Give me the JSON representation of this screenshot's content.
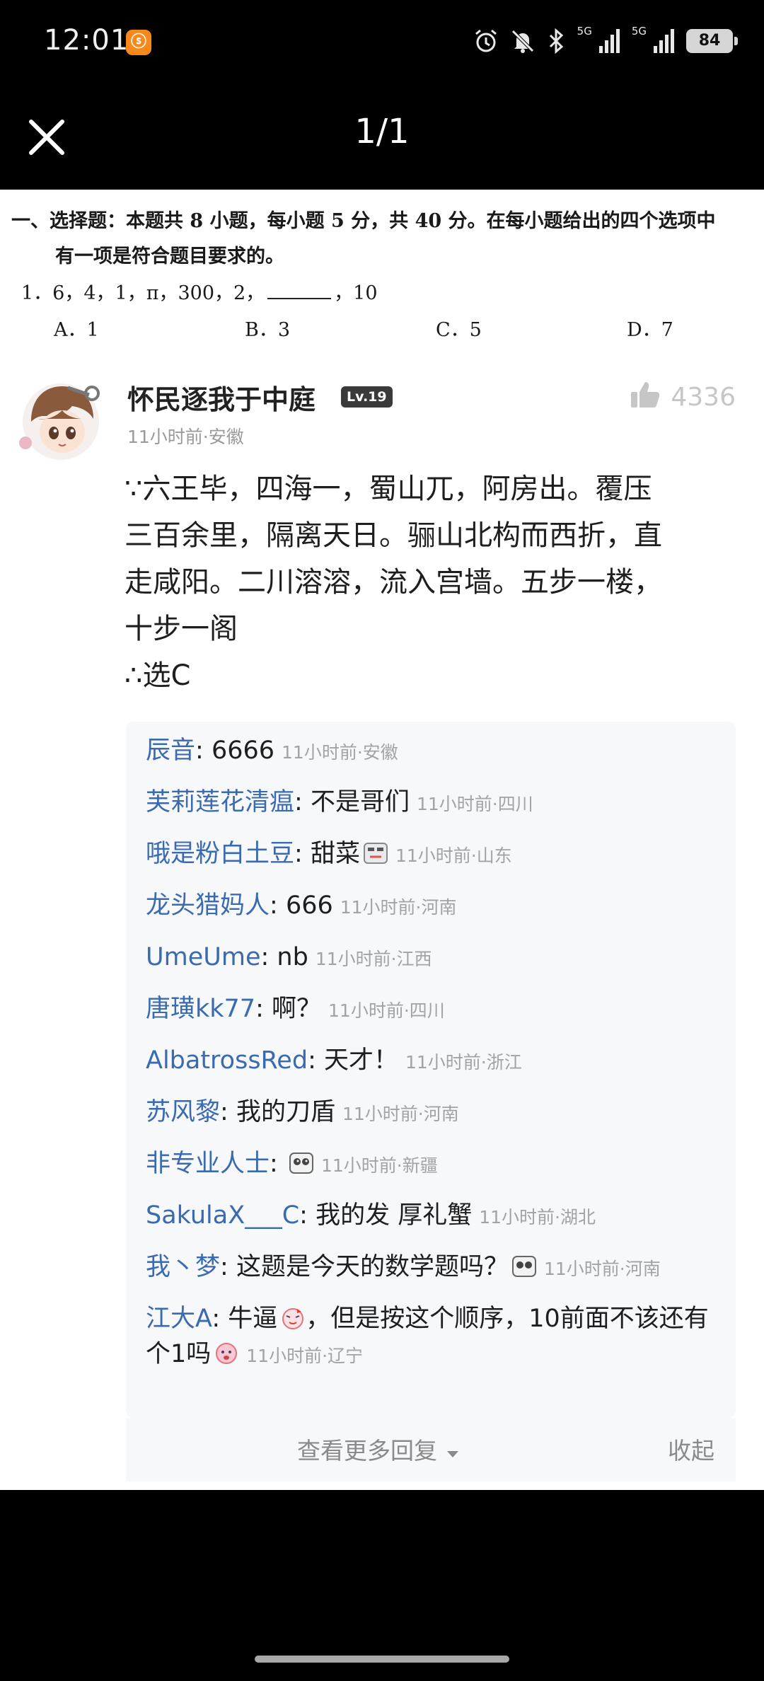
{
  "status_bar": {
    "time": "12:01",
    "net1": "5G",
    "net2": "5G",
    "battery": "84",
    "icons": [
      "alarm-icon",
      "mute-icon",
      "bluetooth-icon",
      "signal-icon",
      "signal-icon",
      "battery-icon"
    ]
  },
  "viewer": {
    "counter": "1/1",
    "close_icon": "close-icon"
  },
  "question": {
    "header_line1": "一、选择题：本题共 8 小题，每小题 5 分，共 40 分。在每小题给出的四个选项中",
    "header_line2": "有一项是符合题目要求的。",
    "stem_before": "1．6，4，1，π，300，2，",
    "stem_after": "，10",
    "options": [
      "A．1",
      "B．3",
      "C．5",
      "D．7"
    ]
  },
  "comment": {
    "username": "怀民逐我于中庭",
    "level": "Lv.19",
    "likes": "4336",
    "meta": "11小时前·安徽",
    "text_lines": [
      "∵六王毕，四海一，蜀山兀，阿房出。覆压",
      "三百余里，隔离天日。骊山北构而西折，直",
      "走咸阳。二川溶溶，流入宫墙。五步一楼，",
      "十步一阁",
      "∴选C"
    ]
  },
  "replies": [
    {
      "user": "辰音",
      "text": "6666",
      "time": "11小时前·安徽"
    },
    {
      "user": "芙莉莲花清瘟",
      "text": "不是哥们",
      "time": "11小时前·四川"
    },
    {
      "user": "哦是粉白土豆",
      "text": "甜菜",
      "time": "11小时前·山东"
    },
    {
      "user": "龙头猎妈人",
      "text": "666",
      "time": "11小时前·河南"
    },
    {
      "user": "UmeUme",
      "text": "nb",
      "time": "11小时前·江西"
    },
    {
      "user": "唐璜kk77",
      "text": "啊？",
      "time": "11小时前·四川"
    },
    {
      "user": "AlbatrossRed",
      "text": "天才！",
      "time": "11小时前·浙江"
    },
    {
      "user": "苏风黎",
      "text": "我的刀盾",
      "time": "11小时前·河南"
    },
    {
      "user": "非专业人士",
      "text": "",
      "time": "11小时前·新疆"
    },
    {
      "user": "SakulaX___C",
      "text": "我的发 厚礼蟹",
      "time": "11小时前·湖北"
    },
    {
      "user": "我丶梦",
      "text": "这题是今天的数学题吗？",
      "time": "11小时前·河南"
    },
    {
      "user": "江大A",
      "text": "牛逼",
      "text2": "，但是按这个顺序，10前面不该还有个1吗",
      "time": "11小时前·辽宁"
    }
  ],
  "footer": {
    "more": "查看更多回复",
    "collapse": "收起"
  }
}
